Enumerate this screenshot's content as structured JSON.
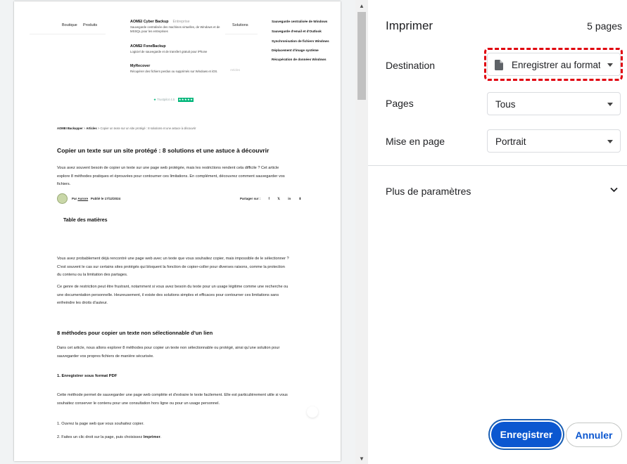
{
  "preview": {
    "nav": {
      "boutique": "Boutique",
      "produits": "Produits",
      "solutions": "Solutions",
      "faded": "Articles"
    },
    "products": [
      {
        "title": "AOMEI Cyber Backup",
        "tag": "Entreprise",
        "desc": "Sauvegarde centralisée des machines virtuelles, de Windows et de MSSQL pour les entreprises"
      },
      {
        "title": "AOMEI FoneBackup",
        "tag": "",
        "desc": "Logiciel de sauvegarde et de transfert gratuit pour iPhone"
      },
      {
        "title": "MyRecover",
        "tag": "",
        "desc": "Récupérer des fichiers perdus ou supprimés sur Windows et iOS."
      }
    ],
    "solutions": [
      "Sauvegarde centralisée de Windows",
      "Sauvegarde d'email et d'Outlook",
      "Synchronisation de fichiers Windows",
      "Déplacement d'image système",
      "Récupération de données Windows"
    ],
    "trustpilot": {
      "label": "Trustpilot",
      "score": "4.5",
      "stars": "★★★★★"
    },
    "breadcrumb": {
      "root": "AOMEI Backupper",
      "section": "Articles",
      "current": "Copier un texte sur un site protégé : 8 solutions et une astuce à découvrir",
      "sep": " > "
    },
    "heading": "Copier un texte sur un site protégé : 8 solutions et une astuce à découvrir",
    "intro": "Vous avez souvent besoin de copier un texte sur une page web protégée, mais les restrictions rendent cela difficile ? Cet article explore 8 méthodes pratiques et éprouvées pour contourner ces limitations. En complément, découvrez comment sauvegarder vos fichiers.",
    "author": {
      "by": "Par",
      "name": "Aurore",
      "published": "Publié le 17/12/2024",
      "share": "Partager sur :",
      "icons": [
        "f",
        "𝕏",
        "in",
        "⬇"
      ]
    },
    "toc": "Table des matières",
    "p1": "Vous avez probablement déjà rencontré une page web avec un texte que vous souhaitez copier, mais impossible de le sélectionner ? C'est souvent le cas sur certains sites protégés qui bloquent la fonction de copier-coller pour diverses raisons, comme la protection du contenu ou la limitation des partages.",
    "p2": "Ce genre de restriction peut être frustrant, notamment si vous avez besoin du texte pour un usage légitime comme une recherche ou une documentation personnelle. Heureusement, il existe des solutions simples et efficaces pour contourner ces limitations sans enfreindre les droits d'auteur.",
    "h2": "8 méthodes pour copier un texte non sélectionnable d'un lien",
    "p3": "Dans cet article, nous allons explorer 8 méthodes pour copier un texte non sélectionnable ou protégé, ainsi qu'une solution pour sauvegarder vos propres fichiers de manière sécurisée.",
    "h3": "1. Enregistrer sous format PDF",
    "p4": "Cette méthode permet de sauvegarder une page web complète et d'extraire le texte facilement. Elle est particulièrement utile si vous souhaitez conserver le contenu pour une consultation hors ligne ou pour un usage personnel.",
    "step1": "1. Ouvrez la page web que vous souhaitez copier.",
    "step2_pre": "2. Faites un clic droit sur la page, puis choisissez ",
    "step2_bold": "Imprimer",
    "step2_post": "."
  },
  "panel": {
    "title": "Imprimer",
    "page_count": "5 pages",
    "destination_label": "Destination",
    "destination_value": "Enregistrer au format PDF",
    "pages_label": "Pages",
    "pages_value": "Tous",
    "layout_label": "Mise en page",
    "layout_value": "Portrait",
    "more_settings": "Plus de paramètres",
    "save_button": "Enregistrer",
    "cancel_button": "Annuler"
  },
  "colors": {
    "accent": "#0b57d0",
    "highlight": "#e0000d",
    "trustpilot": "#00b67a"
  }
}
